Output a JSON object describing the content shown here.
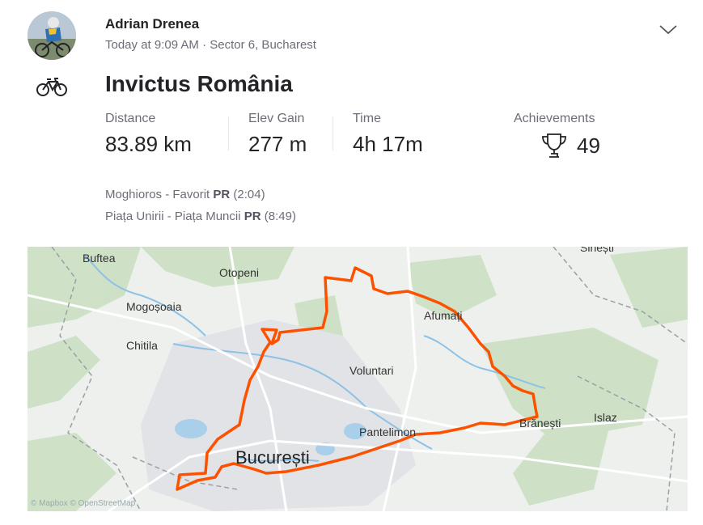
{
  "athlete": {
    "name": "Adrian Drenea",
    "meta": "Today at 9:09 AM · Sector 6, Bucharest"
  },
  "activity": {
    "title": "Invictus România",
    "sport_icon": "bike-icon"
  },
  "stats": [
    {
      "label": "Distance",
      "value": "83.89 km"
    },
    {
      "label": "Elev Gain",
      "value": "277 m"
    },
    {
      "label": "Time",
      "value": "4h 17m"
    }
  ],
  "achievements": {
    "label": "Achievements",
    "value": "49",
    "icon": "trophy-icon"
  },
  "segments": [
    {
      "name": "Moghioros - Favorit",
      "badge": "PR",
      "time": "(2:04)"
    },
    {
      "name": "Piața Unirii - Piața Muncii",
      "badge": "PR",
      "time": "(8:49)"
    }
  ],
  "map": {
    "route_color": "#fc5200",
    "labels": {
      "buftea": "Buftea",
      "otopeni": "Otopeni",
      "sinesti": "Sinești",
      "mogosoaia": "Mogoșoaia",
      "afumati": "Afumați",
      "chitila": "Chitila",
      "voluntari": "Voluntari",
      "branesti": "Brănești",
      "islaz": "Islaz",
      "pantelimon": "Pantelimon",
      "bucuresti": "București"
    },
    "attribution": "© Mapbox © OpenStreetMap"
  }
}
